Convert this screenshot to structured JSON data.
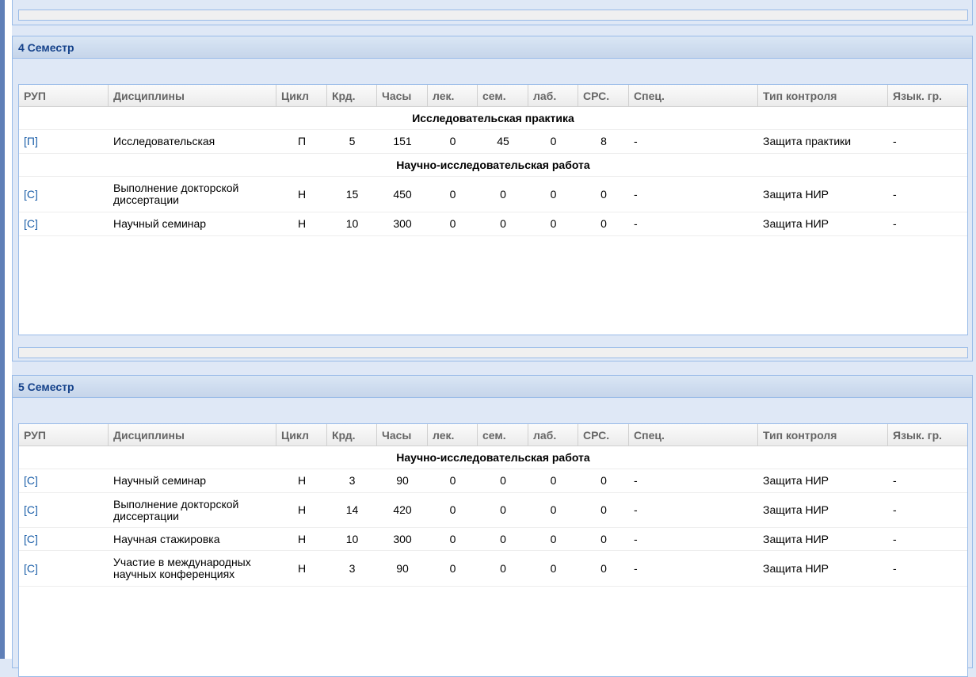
{
  "columns": [
    "РУП",
    "Дисциплины",
    "Цикл",
    "Крд.",
    "Часы",
    "лек.",
    "сем.",
    "лаб.",
    "СРС.",
    "Спец.",
    "Тип контроля",
    "Язык. гр."
  ],
  "semesters": [
    {
      "title": "4 Семестр",
      "groups": [
        {
          "name": "Исследовательская практика",
          "rows": [
            {
              "rup": "[П]",
              "discipline": "Исследовательская",
              "cycle": "П",
              "credits": "5",
              "hours": "151",
              "lek": "0",
              "sem": "45",
              "lab": "0",
              "srs": "8",
              "spec": "-",
              "control": "Защита практики",
              "lang": "-"
            }
          ]
        },
        {
          "name": "Научно-исследовательская работа",
          "rows": [
            {
              "rup": "[С]",
              "discipline": "Выполнение докторской диссертации",
              "cycle": "Н",
              "credits": "15",
              "hours": "450",
              "lek": "0",
              "sem": "0",
              "lab": "0",
              "srs": "0",
              "spec": "-",
              "control": "Защита НИР",
              "lang": "-"
            },
            {
              "rup": "[С]",
              "discipline": "Научный семинар",
              "cycle": "Н",
              "credits": "10",
              "hours": "300",
              "lek": "0",
              "sem": "0",
              "lab": "0",
              "srs": "0",
              "spec": "-",
              "control": "Защита НИР",
              "lang": "-"
            }
          ]
        }
      ]
    },
    {
      "title": "5 Семестр",
      "groups": [
        {
          "name": "Научно-исследовательская работа",
          "rows": [
            {
              "rup": "[С]",
              "discipline": "Научный семинар",
              "cycle": "Н",
              "credits": "3",
              "hours": "90",
              "lek": "0",
              "sem": "0",
              "lab": "0",
              "srs": "0",
              "spec": "-",
              "control": "Защита НИР",
              "lang": "-"
            },
            {
              "rup": "[С]",
              "discipline": "Выполнение докторской диссертации",
              "cycle": "Н",
              "credits": "14",
              "hours": "420",
              "lek": "0",
              "sem": "0",
              "lab": "0",
              "srs": "0",
              "spec": "-",
              "control": "Защита НИР",
              "lang": "-"
            },
            {
              "rup": "[С]",
              "discipline": "Научная стажировка",
              "cycle": "Н",
              "credits": "10",
              "hours": "300",
              "lek": "0",
              "sem": "0",
              "lab": "0",
              "srs": "0",
              "spec": "-",
              "control": "Защита НИР",
              "lang": "-"
            },
            {
              "rup": "[С]",
              "discipline": "Участие в международных научных конференциях",
              "cycle": "Н",
              "credits": "3",
              "hours": "90",
              "lek": "0",
              "sem": "0",
              "lab": "0",
              "srs": "0",
              "spec": "-",
              "control": "Защита НИР",
              "lang": "-"
            }
          ]
        }
      ]
    }
  ]
}
